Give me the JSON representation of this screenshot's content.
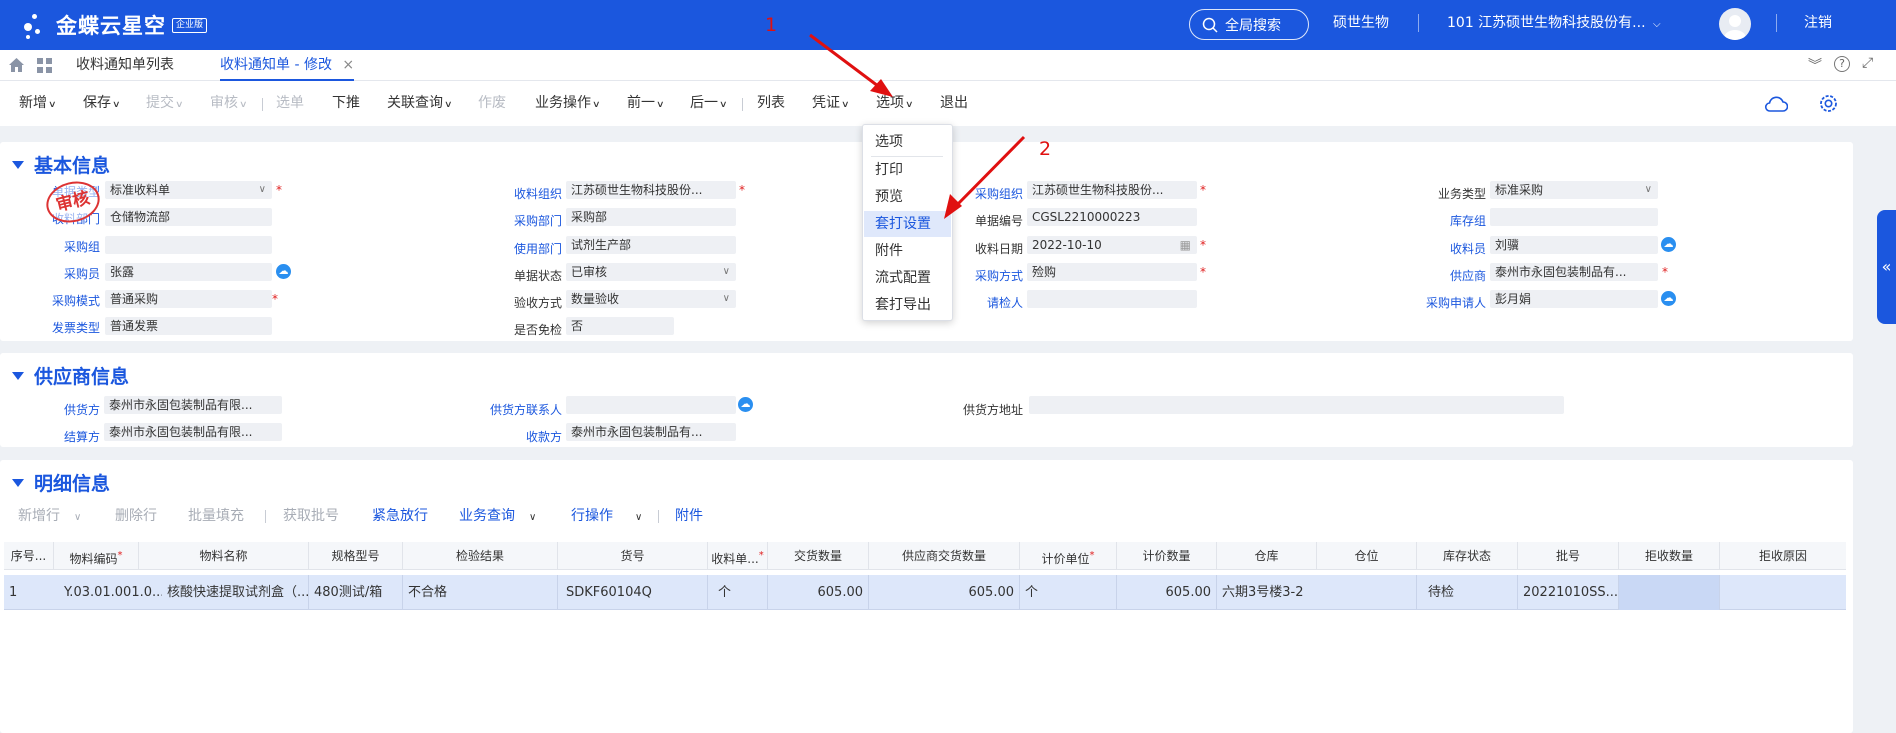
{
  "header": {
    "logo_text": "金蝶云星空",
    "logo_badge": "企业版",
    "search_label": "全局搜索",
    "user_name": "硕世生物",
    "org_name": "101 江苏硕世生物科技股份有...",
    "logout": "注销",
    "brand_color": "#1b57de"
  },
  "tabs": [
    {
      "label": "收料通知单列表"
    },
    {
      "label": "收料通知单 - 修改"
    }
  ],
  "toolbar": {
    "items": [
      "新增",
      "保存",
      "提交",
      "审核",
      "选单",
      "下推",
      "关联查询",
      "作废",
      "业务操作",
      "前一",
      "后一",
      "列表",
      "凭证",
      "选项",
      "退出"
    ]
  },
  "options_menu": {
    "items": [
      "选项",
      "打印",
      "预览",
      "套打设置",
      "附件",
      "流式配置",
      "套打导出"
    ],
    "highlighted": "套打设置"
  },
  "annotations": {
    "step1": "1",
    "step2": "2"
  },
  "basic_info": {
    "title": "基本信息",
    "stamp": "审核",
    "labels": {
      "doc_type": "单据类型",
      "receive_dept": "收料部门",
      "purchase_group": "采购组",
      "purchaser": "采购员",
      "purchase_mode": "采购模式",
      "invoice_type": "发票类型",
      "receive_org": "收料组织",
      "purchase_dept": "采购部门",
      "use_dept": "使用部门",
      "doc_status": "单据状态",
      "check_method": "验收方式",
      "exempt_check": "是否免检",
      "purchase_org": "采购组织",
      "doc_no": "单据编号",
      "receive_date": "收料日期",
      "purchase_method": "采购方式",
      "inspector": "请检人",
      "biz_type": "业务类型",
      "stock_group": "库存组",
      "receiver": "收料员",
      "supplier": "供应商",
      "requester": "采购申请人"
    },
    "values": {
      "doc_type": "标准收料单",
      "receive_dept": "仓储物流部",
      "purchase_group": "",
      "purchaser": "张露",
      "purchase_mode": "普通采购",
      "invoice_type": "普通发票",
      "receive_org": "江苏硕世生物科技股份...",
      "purchase_dept": "采购部",
      "use_dept": "试剂生产部",
      "doc_status": "已审核",
      "check_method": "数量验收",
      "exempt_check": "否",
      "purchase_org": "江苏硕世生物科技股份...",
      "doc_no": "CGSL2210000223",
      "receive_date": "2022-10-10",
      "purchase_method": "殓购",
      "inspector": "",
      "biz_type": "标准采购",
      "stock_group": "",
      "receiver": "刘骥",
      "supplier": "泰州市永固包装制品有...",
      "requester": "彭月娟"
    }
  },
  "supplier_info": {
    "title": "供应商信息",
    "labels": {
      "delivery_party": "供货方",
      "settle_party": "结算方",
      "delivery_contact": "供货方联系人",
      "payee": "收款方",
      "delivery_address": "供货方地址"
    },
    "values": {
      "delivery_party": "泰州市永固包装制品有限...",
      "settle_party": "泰州市永固包装制品有限...",
      "delivery_contact": "",
      "payee": "泰州市永固包装制品有...",
      "delivery_address": ""
    }
  },
  "detail_info": {
    "title": "明细信息",
    "toolbar": [
      "新增行",
      "删除行",
      "批量填充",
      "获取批号",
      "紧急放行",
      "业务查询",
      "行操作",
      "附件"
    ],
    "columns": [
      "序号...",
      "物料编码",
      "物料名称",
      "规格型号",
      "检验结果",
      "货号",
      "收料单...",
      "交货数量",
      "供应商交货数量",
      "计价单位",
      "计价数量",
      "仓库",
      "仓位",
      "库存状态",
      "批号",
      "拒收数量",
      "拒收原因"
    ],
    "rows": [
      [
        "1",
        "Y.03.01.001.0...",
        "核酸快速提取试剂盒（...",
        "480测试/箱",
        "不合格",
        "SDKF60104Q",
        "个",
        "605.00",
        "605.00",
        "个",
        "605.00",
        "六期3号楼3-2",
        "",
        "待检",
        "20221010SS...",
        "",
        ""
      ]
    ]
  }
}
